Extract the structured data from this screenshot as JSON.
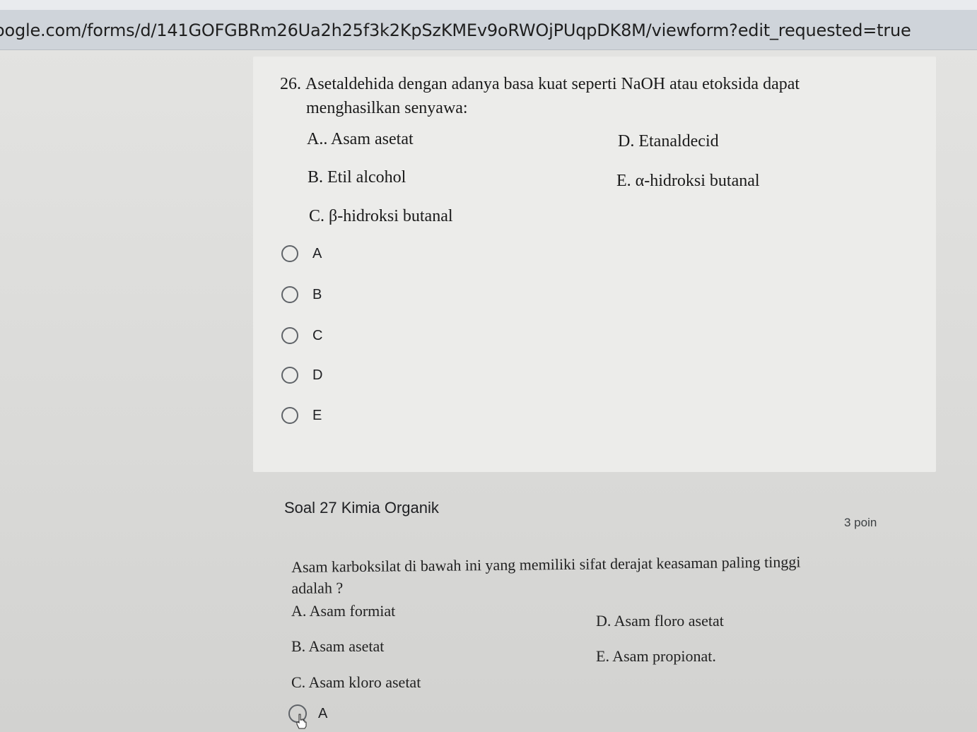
{
  "browser": {
    "url": "oogle.com/forms/d/141GOFGBRm26Ua2h25f3k2KpSzKMEv9oRWOjPUqpDK8M/viewform?edit_requested=true"
  },
  "question26": {
    "number": "26.",
    "text_line1": "Asetaldehida dengan adanya basa kuat seperti NaOH atau etoksida dapat",
    "text_line2": "menghasilkan senyawa:",
    "options": {
      "a": "A.. Asam asetat",
      "b": "B. Etil alcohol",
      "c": "C. β-hidroksi butanal",
      "d": "D. Etanaldecid",
      "e": "E. α-hidroksi butanal"
    },
    "choices": [
      "A",
      "B",
      "C",
      "D",
      "E"
    ]
  },
  "question27": {
    "section_title": "Soal 27 Kimia Organik",
    "points": "3 poin",
    "text_line1": "Asam karboksilat di bawah ini yang memiliki sifat derajat keasaman paling tinggi",
    "text_line2": "adalah ?",
    "options": {
      "a": "A. Asam formiat",
      "b": "B. Asam asetat",
      "c": "C. Asam kloro asetat",
      "d": "D. Asam floro asetat",
      "e": "E. Asam propionat."
    },
    "choices": [
      "A"
    ]
  }
}
